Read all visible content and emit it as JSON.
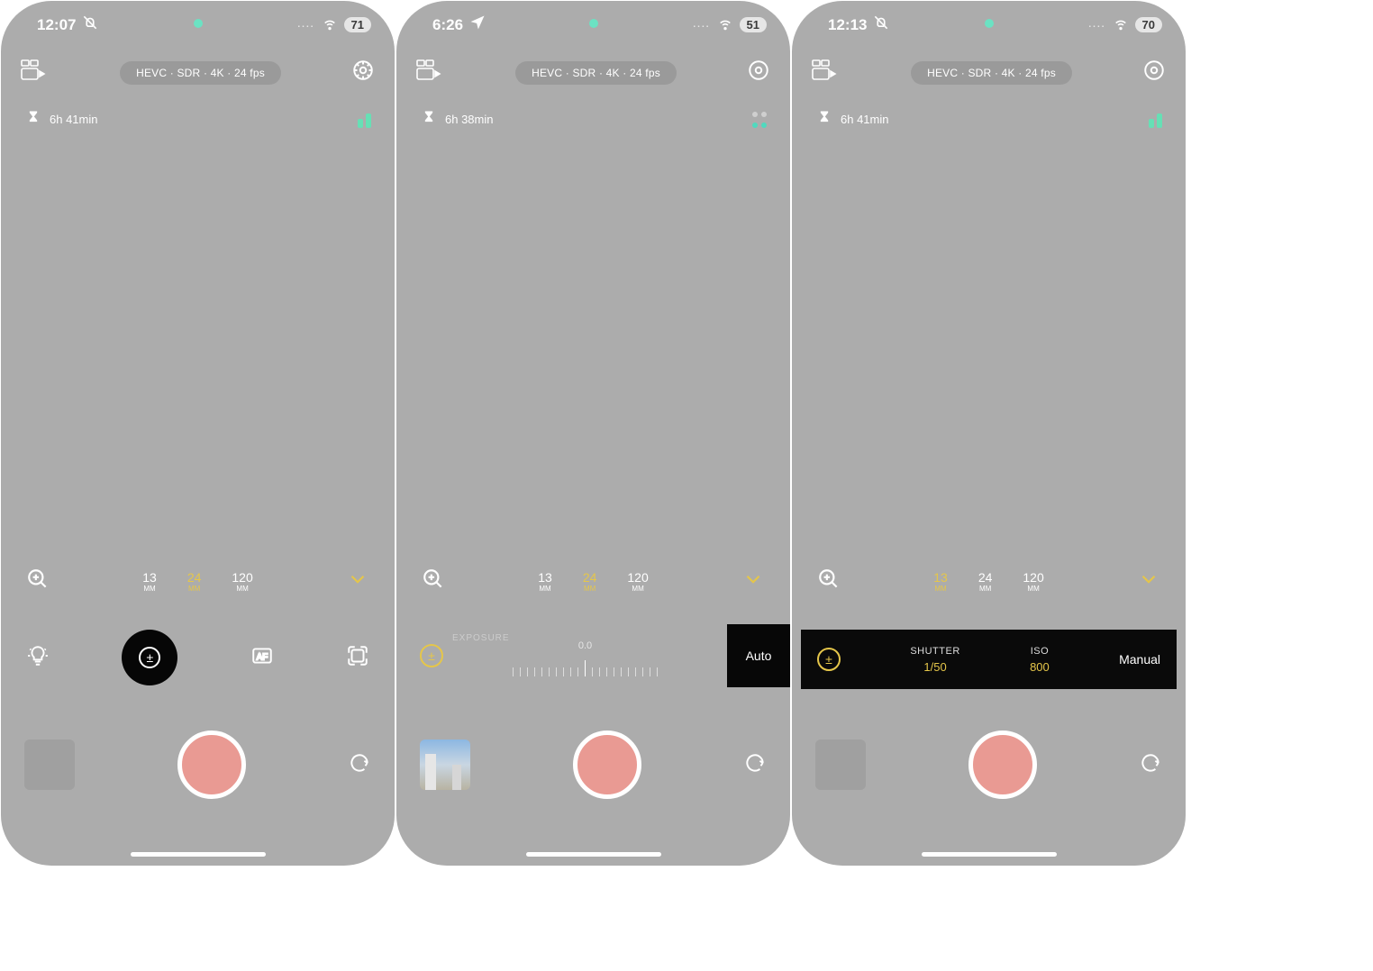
{
  "screens": [
    {
      "status": {
        "time": "12:07",
        "status_icon": "bell-slash",
        "battery": "71"
      },
      "format_pill": "HEVC · SDR · 4K · 24 fps",
      "storage": "6h 41min",
      "level_style": "bars-green",
      "focal": {
        "options": [
          "13",
          "24",
          "120"
        ],
        "unit": "MM",
        "active_index": 1
      },
      "bottom": {
        "thumb": "empty"
      }
    },
    {
      "status": {
        "time": "6:26",
        "status_icon": "location",
        "battery": "51"
      },
      "format_pill": "HEVC · SDR · 4K · 24 fps",
      "storage": "6h 38min",
      "level_style": "dots-teal",
      "focal": {
        "options": [
          "13",
          "24",
          "120"
        ],
        "unit": "MM",
        "active_index": 1
      },
      "exposure": {
        "label": "EXPOSURE",
        "value": "0.0",
        "mode": "Auto"
      },
      "bottom": {
        "thumb": "photo"
      }
    },
    {
      "status": {
        "time": "12:13",
        "status_icon": "bell-slash",
        "battery": "70"
      },
      "format_pill": "HEVC · SDR · 4K · 24 fps",
      "storage": "6h 41min",
      "level_style": "bars-green",
      "focal": {
        "options": [
          "13",
          "24",
          "120"
        ],
        "unit": "MM",
        "active_index": 0
      },
      "manual": {
        "shutter_label": "SHUTTER",
        "shutter_value": "1/50",
        "iso_label": "ISO",
        "iso_value": "800",
        "mode": "Manual"
      },
      "bottom": {
        "thumb": "empty"
      }
    }
  ]
}
